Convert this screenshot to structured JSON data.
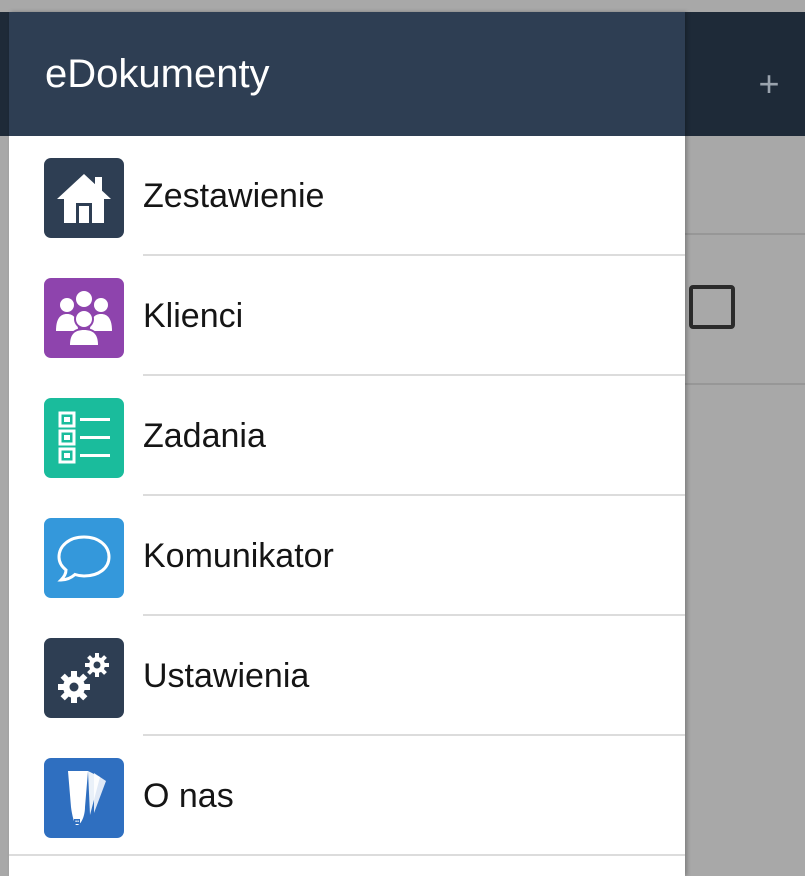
{
  "app": {
    "title": "eDokumenty"
  },
  "background": {
    "add_label": "+"
  },
  "menu": {
    "items": [
      {
        "label": "Zestawienie",
        "icon": "home-icon",
        "color": "#2e3e53"
      },
      {
        "label": "Klienci",
        "icon": "people-icon",
        "color": "#8e44ad"
      },
      {
        "label": "Zadania",
        "icon": "checklist-icon",
        "color": "#1abc9c"
      },
      {
        "label": "Komunikator",
        "icon": "chat-bubble-icon",
        "color": "#3498db"
      },
      {
        "label": "Ustawienia",
        "icon": "gears-icon",
        "color": "#2e3e53"
      },
      {
        "label": "O nas",
        "icon": "document-icon",
        "color": "#2f6fc0"
      }
    ]
  }
}
